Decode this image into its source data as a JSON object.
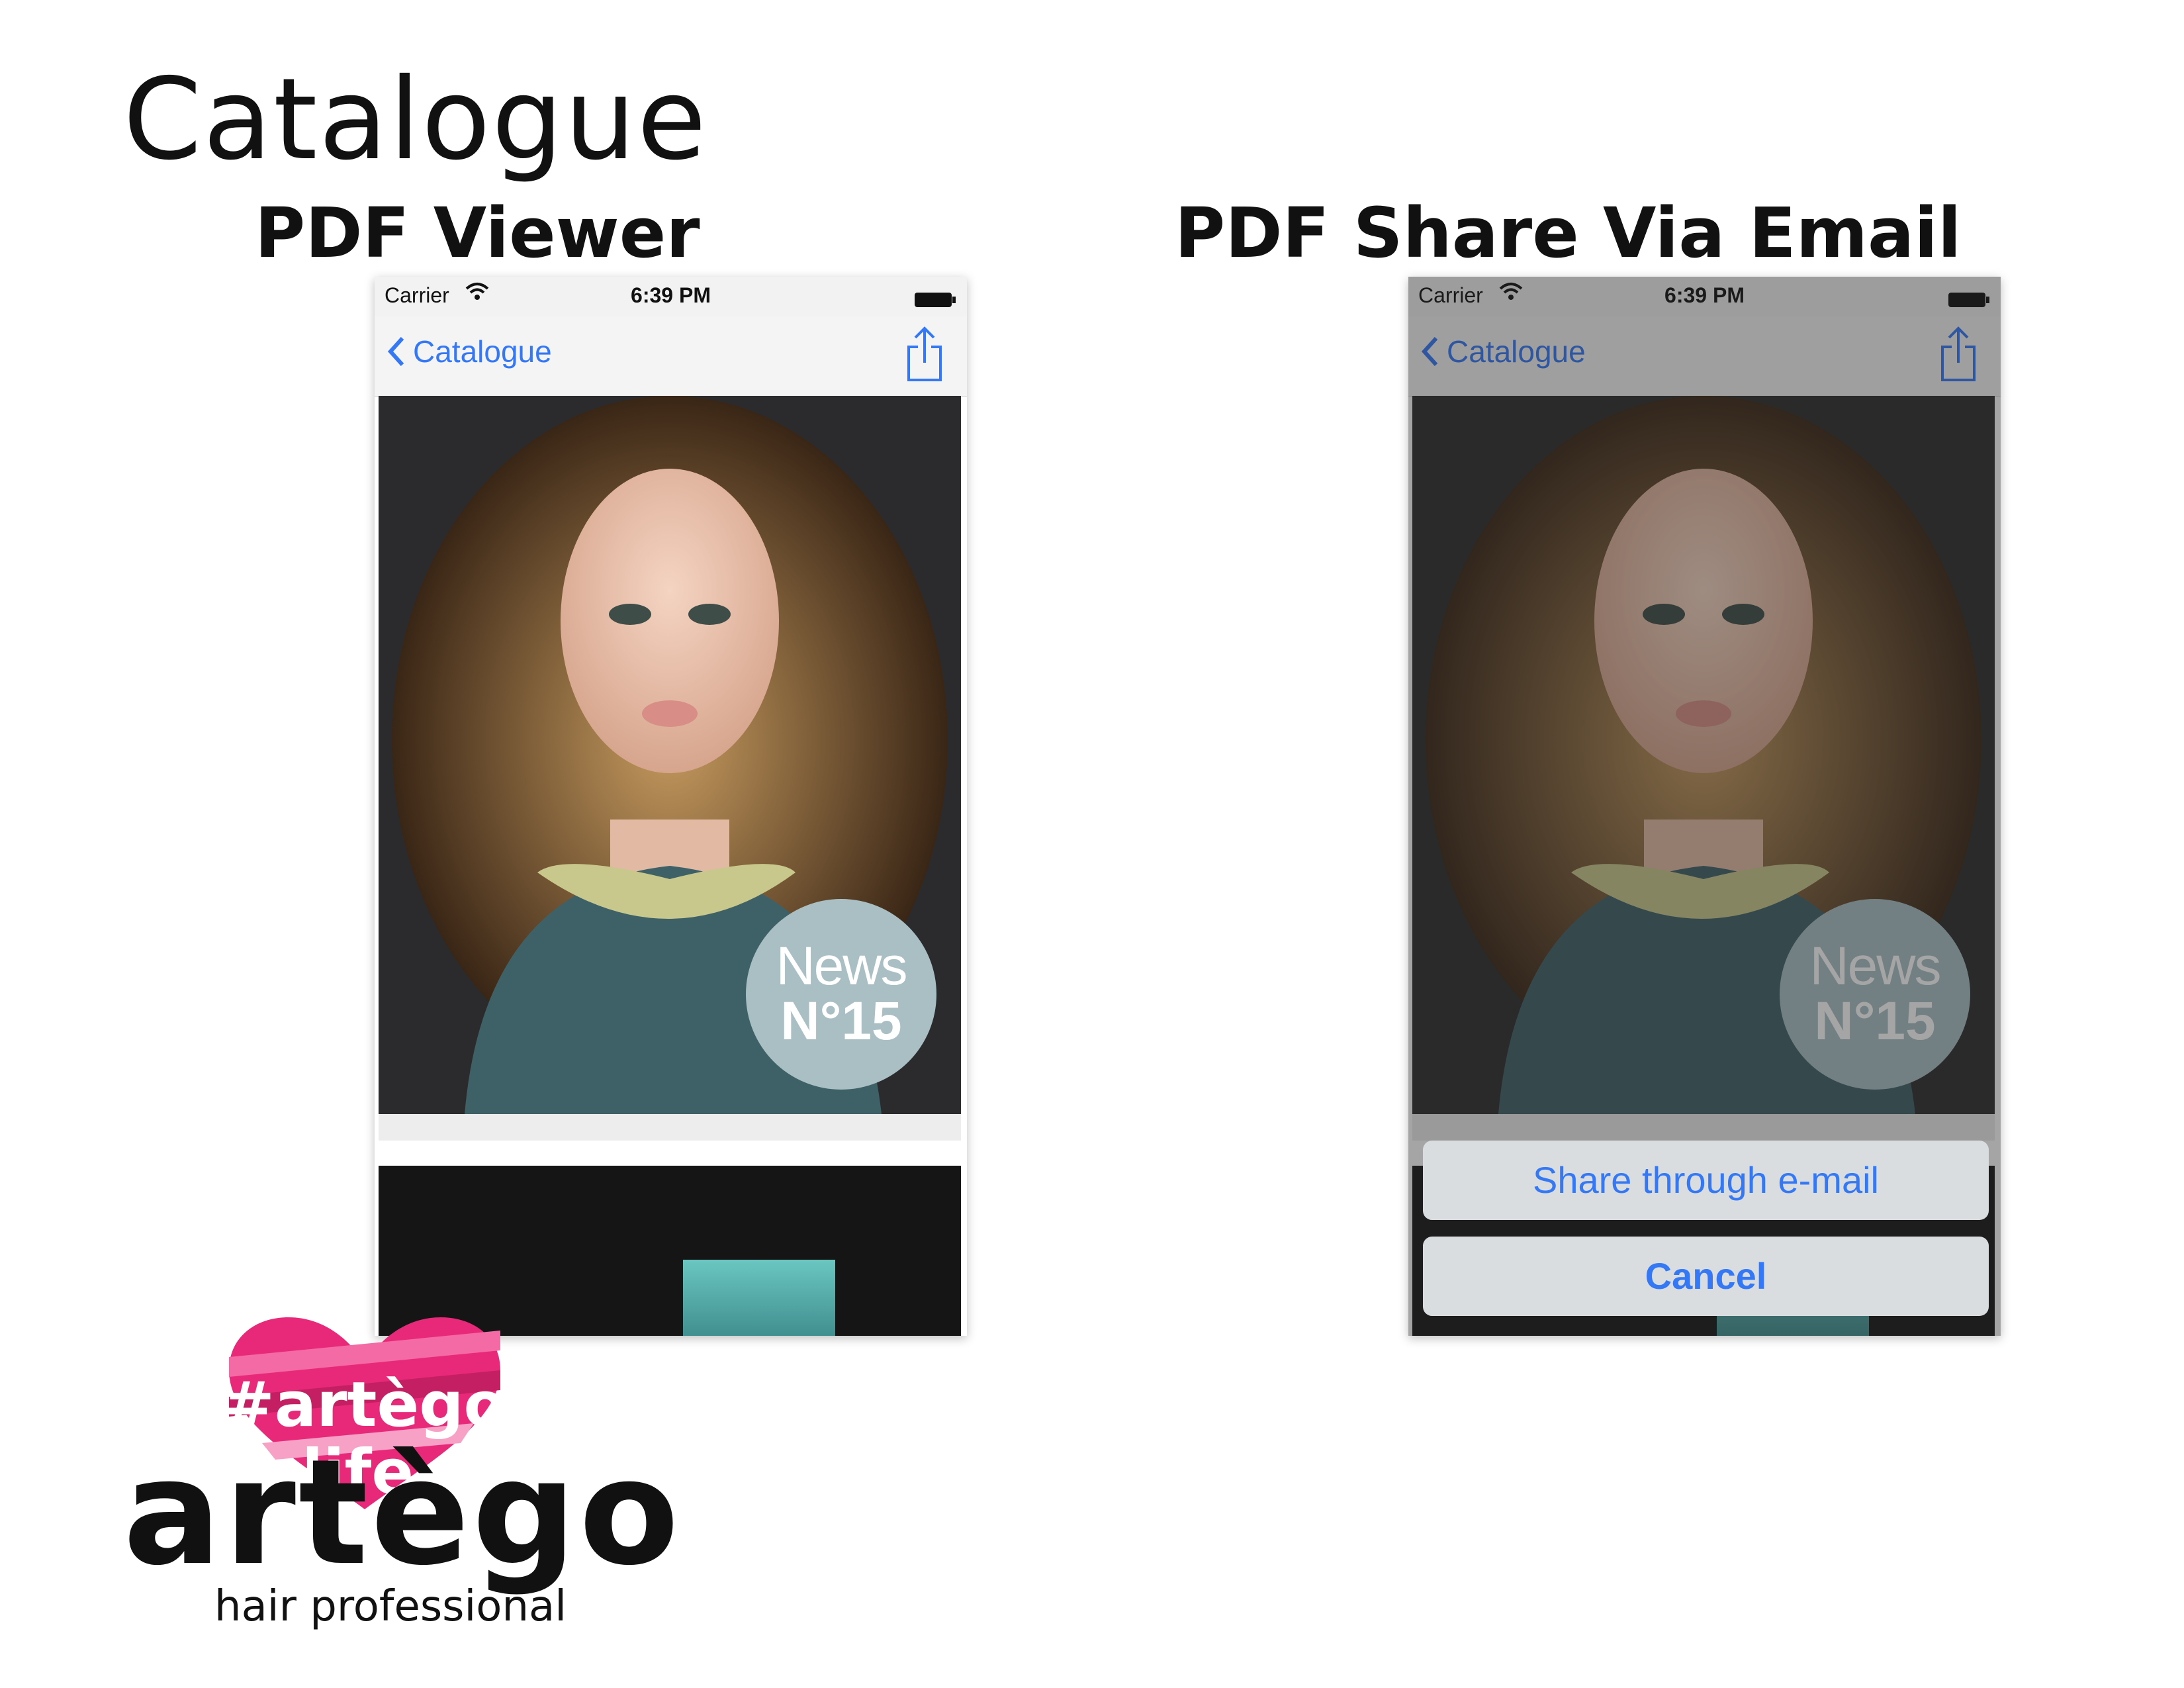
{
  "page": {
    "title": "Catalogue",
    "left_label": "PDF Viewer",
    "right_label": "PDF Share Via Email"
  },
  "phone": {
    "carrier": "Carrier",
    "time": "6:39 PM",
    "back_label": "Catalogue",
    "cover_badge_line1": "News",
    "cover_badge_line2": "N°15"
  },
  "share_sheet": {
    "share_label": "Share through e-mail",
    "cancel_label": "Cancel"
  },
  "logo": {
    "hashtag": "#artègo",
    "heart_word": "life",
    "brand": "artègo",
    "tagline": "hair professional"
  },
  "colors": {
    "ios_blue": "#3478f6",
    "badge": "#a9bfc4",
    "heart_pink": "#e8297a"
  }
}
